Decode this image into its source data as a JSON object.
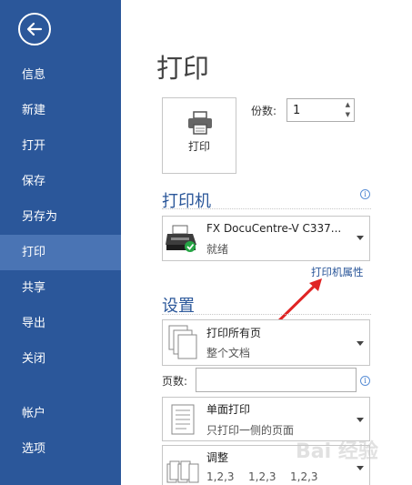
{
  "sidebar": {
    "items": [
      {
        "label": "信息"
      },
      {
        "label": "新建"
      },
      {
        "label": "打开"
      },
      {
        "label": "保存"
      },
      {
        "label": "另存为"
      },
      {
        "label": "打印"
      },
      {
        "label": "共享"
      },
      {
        "label": "导出"
      },
      {
        "label": "关闭"
      },
      {
        "label": "帐户"
      },
      {
        "label": "选项"
      }
    ],
    "active": "打印"
  },
  "main": {
    "title": "打印",
    "print_button": "打印",
    "copies": {
      "label": "份数:",
      "value": "1"
    },
    "printer_section": {
      "heading": "打印机",
      "name": "FX DocuCentre-V C337...",
      "status": "就绪",
      "properties_link": "打印机属性"
    },
    "settings_section": {
      "heading": "设置",
      "range": {
        "main": "打印所有页",
        "sub": "整个文档"
      },
      "pages_label": "页数:",
      "sides": {
        "main": "单面打印",
        "sub": "只打印一侧的页面"
      },
      "collate": {
        "main": "调整",
        "sub": [
          "1,2,3",
          "1,2,3",
          "1,2,3"
        ]
      }
    }
  },
  "watermark": "Bai 经验",
  "colors": {
    "sidebar": "#2b579a",
    "sidebar_active": "#4a74b4",
    "accent": "#2b579a",
    "annotation_arrow": "#e02424"
  }
}
